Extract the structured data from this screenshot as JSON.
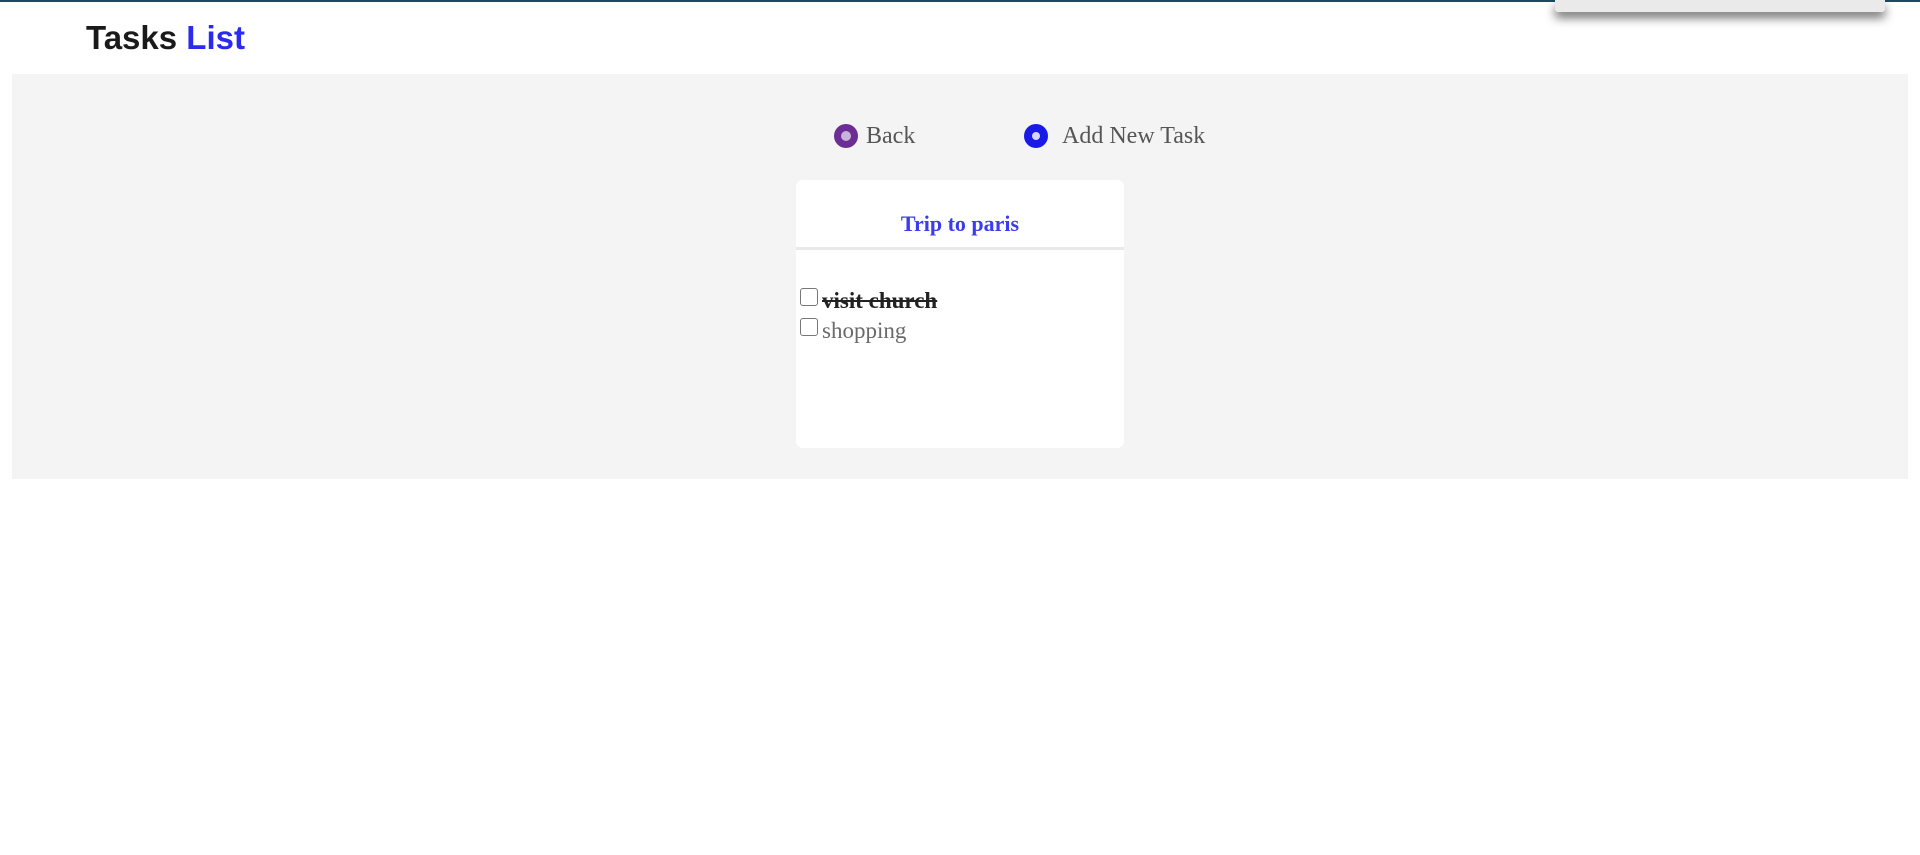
{
  "header": {
    "title_main": "Tasks",
    "title_accent": "List"
  },
  "actions": {
    "back_label": "Back",
    "add_label": "Add New Task"
  },
  "card": {
    "title": "Trip to paris",
    "tasks": [
      {
        "label": "visit church",
        "completed": true
      },
      {
        "label": "shopping",
        "completed": false
      }
    ]
  },
  "colors": {
    "accent": "#2b2bf0",
    "back_icon": "#6b2e94",
    "add_icon": "#1a1ae8",
    "panel_background": "#f4f4f4"
  },
  "icons": {
    "back": "back-icon",
    "add": "add-icon"
  }
}
